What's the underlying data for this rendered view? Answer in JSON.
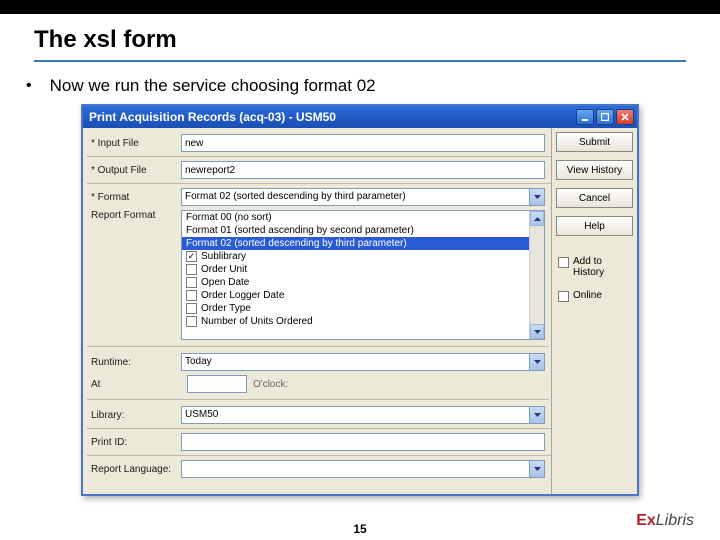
{
  "slide": {
    "title": "The xsl form",
    "bullet": "Now we run the service choosing format 02",
    "pageNumber": "15",
    "logoPrefix": "Ex",
    "logoRest": "Libris"
  },
  "window": {
    "title": "Print Acquisition Records (acq-03) - USM50",
    "fields": {
      "inputFile": {
        "label": "* Input File",
        "value": "new"
      },
      "outputFile": {
        "label": "* Output File",
        "value": "newreport2"
      },
      "format": {
        "label": "* Format",
        "value": "Format 02 (sorted descending by third parameter)"
      },
      "reportFormat": {
        "label": "Report Format"
      },
      "runtime": {
        "label": "Runtime:",
        "value": "Today"
      },
      "at": {
        "label": "At",
        "suffix": "O'clock:"
      },
      "library": {
        "label": "Library:",
        "value": "USM50"
      },
      "printId": {
        "label": "Print ID:"
      },
      "reportLanguage": {
        "label": "Report Language:"
      }
    },
    "formatOptions": [
      "Format 00 (no sort)",
      "Format 01 (sorted ascending by second parameter)",
      "Format 02 (sorted descending by third parameter)"
    ],
    "reportChecks": [
      {
        "label": "Sublibrary",
        "checked": true
      },
      {
        "label": "Order Unit",
        "checked": false
      },
      {
        "label": "Open Date",
        "checked": false
      },
      {
        "label": "Order Logger Date",
        "checked": false
      },
      {
        "label": "Order Type",
        "checked": false
      },
      {
        "label": "Number of Units Ordered",
        "checked": false
      }
    ],
    "buttons": {
      "submit": "Submit",
      "viewHistory": "View History",
      "cancel": "Cancel",
      "help": "Help",
      "addToHistory": "Add to History",
      "online": "Online"
    }
  }
}
